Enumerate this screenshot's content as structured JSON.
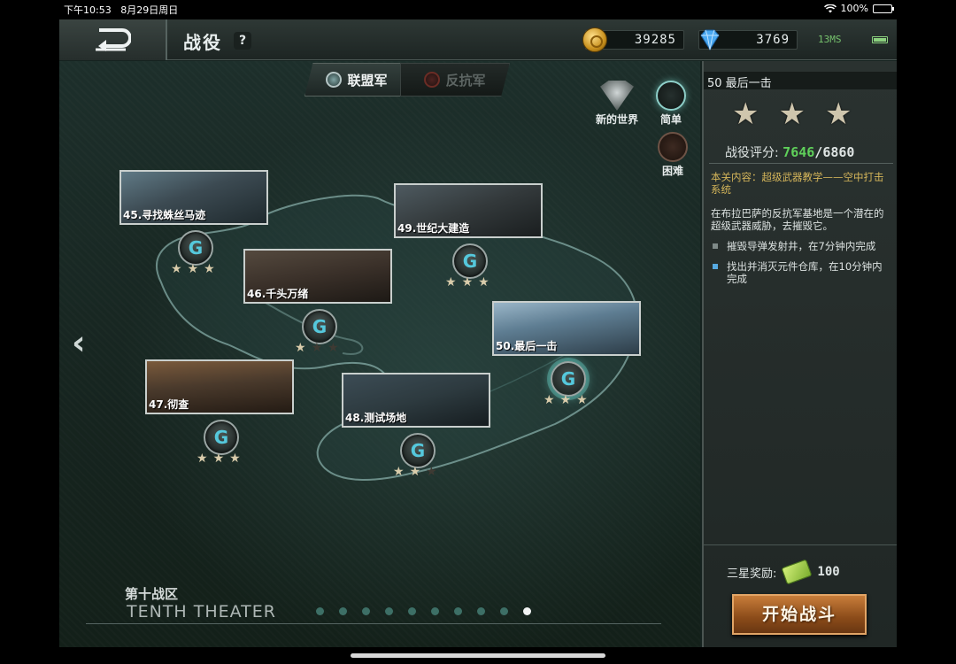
{
  "status_bar": {
    "time": "下午10:53",
    "date": "8月29日周日",
    "battery": "100%"
  },
  "top_bar": {
    "title": "战役",
    "help": "?",
    "gold": "39285",
    "gems": "3769",
    "signal": "13MS"
  },
  "factions": {
    "alliance": "联盟军",
    "rebel": "反抗军",
    "selected": "alliance"
  },
  "difficulty": {
    "new_world": "新的世界",
    "easy": "简单",
    "hard": "困难",
    "selected": "easy"
  },
  "missions": [
    {
      "name": "45.寻找蛛丝马迹",
      "stars": 3
    },
    {
      "name": "46.千头万绪",
      "stars": 1
    },
    {
      "name": "47.彻查",
      "stars": 3
    },
    {
      "name": "48.测试场地",
      "stars": 2
    },
    {
      "name": "49.世纪大建造",
      "stars": 3
    },
    {
      "name": "50.最后一击",
      "stars": 3
    }
  ],
  "theater": {
    "cn": "第十战区",
    "en": "TENTH THEATER",
    "page_count": 10,
    "current_page": 10
  },
  "panel": {
    "mission_title": "50 最后一击",
    "stars": 3,
    "score_label": "战役评分:",
    "score_current": "7646",
    "score_total": "/6860",
    "content": "本关内容：超级武器教学——空中打击系统",
    "description": "在布拉巴萨的反抗军基地是一个潜在的超级武器威胁，去摧毁它。",
    "objective_1": "摧毁导弹发射井，在7分钟内完成",
    "objective_2": "找出并消灭元件仓库，在10分钟内完成",
    "reward_label": "三星奖励:",
    "reward_amount": "100",
    "start_button": "开始战斗"
  },
  "colors": {
    "score_green": "#5fd15a",
    "content_gold": "#d4b55a",
    "start_orange": "#c87d3a",
    "node_cyan": "#55c8dc"
  }
}
